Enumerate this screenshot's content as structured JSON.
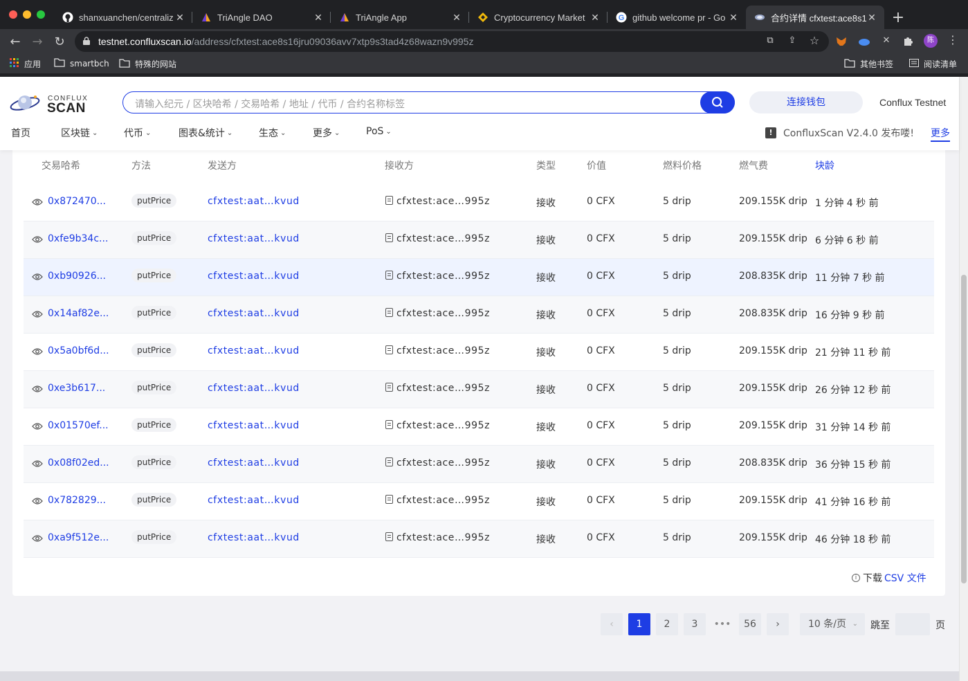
{
  "browser": {
    "tabs": [
      {
        "title": "shanxuanchen/centraliz",
        "icon": "github-icon"
      },
      {
        "title": "TriAngle DAO",
        "icon": "triangle-icon"
      },
      {
        "title": "TriAngle App",
        "icon": "triangle-icon"
      },
      {
        "title": "Cryptocurrency Market",
        "icon": "binance-icon"
      },
      {
        "title": "github welcome pr - Go",
        "icon": "google-icon"
      },
      {
        "title": "合约详情 cfxtest:ace8s1",
        "icon": "confluxscan-icon",
        "active": true
      }
    ],
    "url_host": "testnet.confluxscan.io",
    "url_path": "/address/cfxtest:ace8s16jru09036avv7xtp9s3tad4z68wazn9v995z",
    "bookmarks": {
      "apps": "应用",
      "folder1": "smartbch",
      "folder2": "特殊的网站",
      "other": "其他书签",
      "reading": "阅读清单"
    },
    "profile_initial": "陈"
  },
  "header": {
    "logo_top": "CONFLUX",
    "logo_bottom": "SCAN",
    "search_placeholder": "请输入纪元 / 区块哈希 / 交易哈希 / 地址 / 代币 / 合约名称标签",
    "connect_wallet": "连接钱包",
    "network": "Conflux Testnet",
    "menu": [
      "首页",
      "区块链",
      "代币",
      "图表&统计",
      "生态",
      "更多",
      "PoS"
    ],
    "notice": "ConfluxScan V2.4.0 发布喽!",
    "more": "更多"
  },
  "table": {
    "columns": {
      "hash": "交易哈希",
      "method": "方法",
      "from": "发送方",
      "to": "接收方",
      "type": "类型",
      "value": "价值",
      "gas_price": "燃料价格",
      "gas_fee": "燃气费",
      "age": "块龄"
    },
    "rows": [
      {
        "hash": "0x872470...",
        "method": "putPrice",
        "from": "cfxtest:aat…kvud",
        "to": "cfxtest:ace…995z",
        "type": "接收",
        "value": "0 CFX",
        "gas_price": "5 drip",
        "gas_fee": "209.155K drip",
        "age": "1 分钟 4 秒 前"
      },
      {
        "hash": "0xfe9b34c...",
        "method": "putPrice",
        "from": "cfxtest:aat…kvud",
        "to": "cfxtest:ace…995z",
        "type": "接收",
        "value": "0 CFX",
        "gas_price": "5 drip",
        "gas_fee": "209.155K drip",
        "age": "6 分钟 6 秒 前"
      },
      {
        "hash": "0xb90926...",
        "method": "putPrice",
        "from": "cfxtest:aat…kvud",
        "to": "cfxtest:ace…995z",
        "type": "接收",
        "value": "0 CFX",
        "gas_price": "5 drip",
        "gas_fee": "208.835K drip",
        "age": "11 分钟 7 秒 前"
      },
      {
        "hash": "0x14af82e...",
        "method": "putPrice",
        "from": "cfxtest:aat…kvud",
        "to": "cfxtest:ace…995z",
        "type": "接收",
        "value": "0 CFX",
        "gas_price": "5 drip",
        "gas_fee": "208.835K drip",
        "age": "16 分钟 9 秒 前"
      },
      {
        "hash": "0x5a0bf6d...",
        "method": "putPrice",
        "from": "cfxtest:aat…kvud",
        "to": "cfxtest:ace…995z",
        "type": "接收",
        "value": "0 CFX",
        "gas_price": "5 drip",
        "gas_fee": "209.155K drip",
        "age": "21 分钟 11 秒 前"
      },
      {
        "hash": "0xe3b617...",
        "method": "putPrice",
        "from": "cfxtest:aat…kvud",
        "to": "cfxtest:ace…995z",
        "type": "接收",
        "value": "0 CFX",
        "gas_price": "5 drip",
        "gas_fee": "209.155K drip",
        "age": "26 分钟 12 秒 前"
      },
      {
        "hash": "0x01570ef...",
        "method": "putPrice",
        "from": "cfxtest:aat…kvud",
        "to": "cfxtest:ace…995z",
        "type": "接收",
        "value": "0 CFX",
        "gas_price": "5 drip",
        "gas_fee": "209.155K drip",
        "age": "31 分钟 14 秒 前"
      },
      {
        "hash": "0x08f02ed...",
        "method": "putPrice",
        "from": "cfxtest:aat…kvud",
        "to": "cfxtest:ace…995z",
        "type": "接收",
        "value": "0 CFX",
        "gas_price": "5 drip",
        "gas_fee": "208.835K drip",
        "age": "36 分钟 15 秒 前"
      },
      {
        "hash": "0x782829...",
        "method": "putPrice",
        "from": "cfxtest:aat…kvud",
        "to": "cfxtest:ace…995z",
        "type": "接收",
        "value": "0 CFX",
        "gas_price": "5 drip",
        "gas_fee": "209.155K drip",
        "age": "41 分钟 16 秒 前"
      },
      {
        "hash": "0xa9f512e...",
        "method": "putPrice",
        "from": "cfxtest:aat…kvud",
        "to": "cfxtest:ace…995z",
        "type": "接收",
        "value": "0 CFX",
        "gas_price": "5 drip",
        "gas_fee": "209.155K drip",
        "age": "46 分钟 18 秒 前"
      }
    ],
    "download_prefix": "下载",
    "download_link": "CSV 文件"
  },
  "pagination": {
    "pages": [
      "1",
      "2",
      "3",
      "•••",
      "56"
    ],
    "current": "1",
    "page_size": "10 条/页",
    "jump_label": "跳至",
    "page_suffix": "页"
  },
  "colors": {
    "accent": "#1e3de4",
    "highlight_row": "#eef3ff"
  }
}
